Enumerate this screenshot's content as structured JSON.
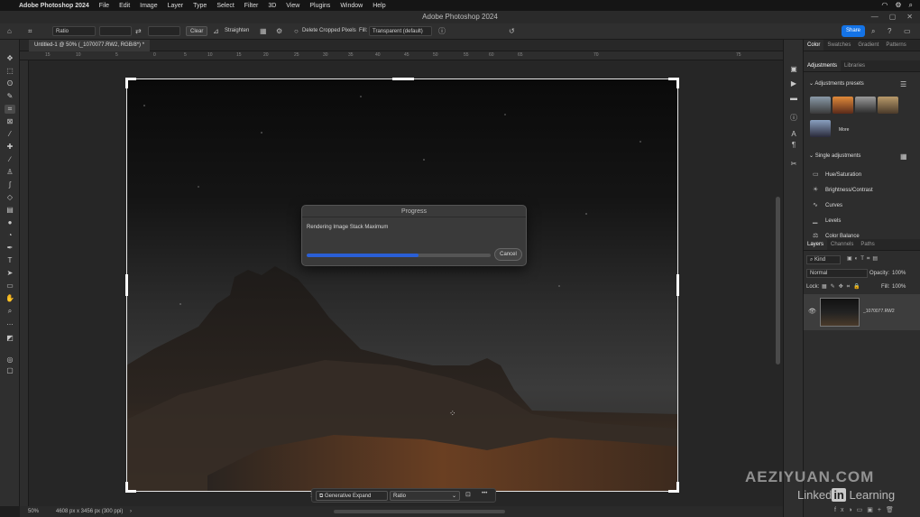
{
  "menubar": {
    "app": "Adobe Photoshop 2024",
    "items": [
      "File",
      "Edit",
      "Image",
      "Layer",
      "Type",
      "Select",
      "Filter",
      "3D",
      "View",
      "Plugins",
      "Window",
      "Help"
    ]
  },
  "titlebar": {
    "title": "Adobe Photoshop 2024"
  },
  "options": {
    "ratio": "Ratio",
    "clear": "Clear",
    "straighten": "Straighten",
    "delete_cropped": "Delete Cropped Pixels",
    "fill_label": "Fill:",
    "fill_value": "Transparent (default)",
    "share": "Share"
  },
  "document": {
    "tab": "Untitled-1 @ 50% (_1070077.RW2, RGB/8*) *"
  },
  "ruler": {
    "ticks": [
      "15",
      "10",
      "5",
      "0",
      "5",
      "10",
      "15",
      "20",
      "25",
      "30",
      "35",
      "40",
      "45",
      "50",
      "55",
      "60",
      "65",
      "70",
      "75"
    ]
  },
  "progress": {
    "title": "Progress",
    "message": "Rendering Image Stack Maximum",
    "cancel": "Cancel",
    "fraction": 0.61
  },
  "context_bar": {
    "generative_expand": "Generative Expand",
    "ratio": "Ratio",
    "more": "•••"
  },
  "status": {
    "zoom": "50%",
    "doc_size": "4608 px x 3456 px (300 ppi)"
  },
  "panels": {
    "top_tabs": [
      "Color",
      "Swatches",
      "Gradient",
      "Patterns"
    ],
    "sub_tabs": [
      "Adjustments",
      "Libraries"
    ],
    "presets_header": "Adjustments presets",
    "more_label": "More",
    "single_header": "Single adjustments",
    "adjustments": [
      "Hue/Saturation",
      "Brightness/Contrast",
      "Curves",
      "Levels",
      "Color Balance"
    ],
    "layer_tabs": [
      "Layers",
      "Channels",
      "Paths"
    ],
    "kind": "Kind",
    "blend": "Normal",
    "opacity_label": "Opacity:",
    "opacity": "100%",
    "lock_label": "Lock:",
    "fill_label": "Fill:",
    "fill": "100%",
    "layer_name": "_1070077.RW2"
  },
  "watermark": {
    "site": "AEZIYUAN.COM",
    "linked": "Linked",
    "in": "in",
    "learning": "Learning"
  },
  "colors": {
    "accent": "#1473e6",
    "progress": "#2a5fd6"
  }
}
